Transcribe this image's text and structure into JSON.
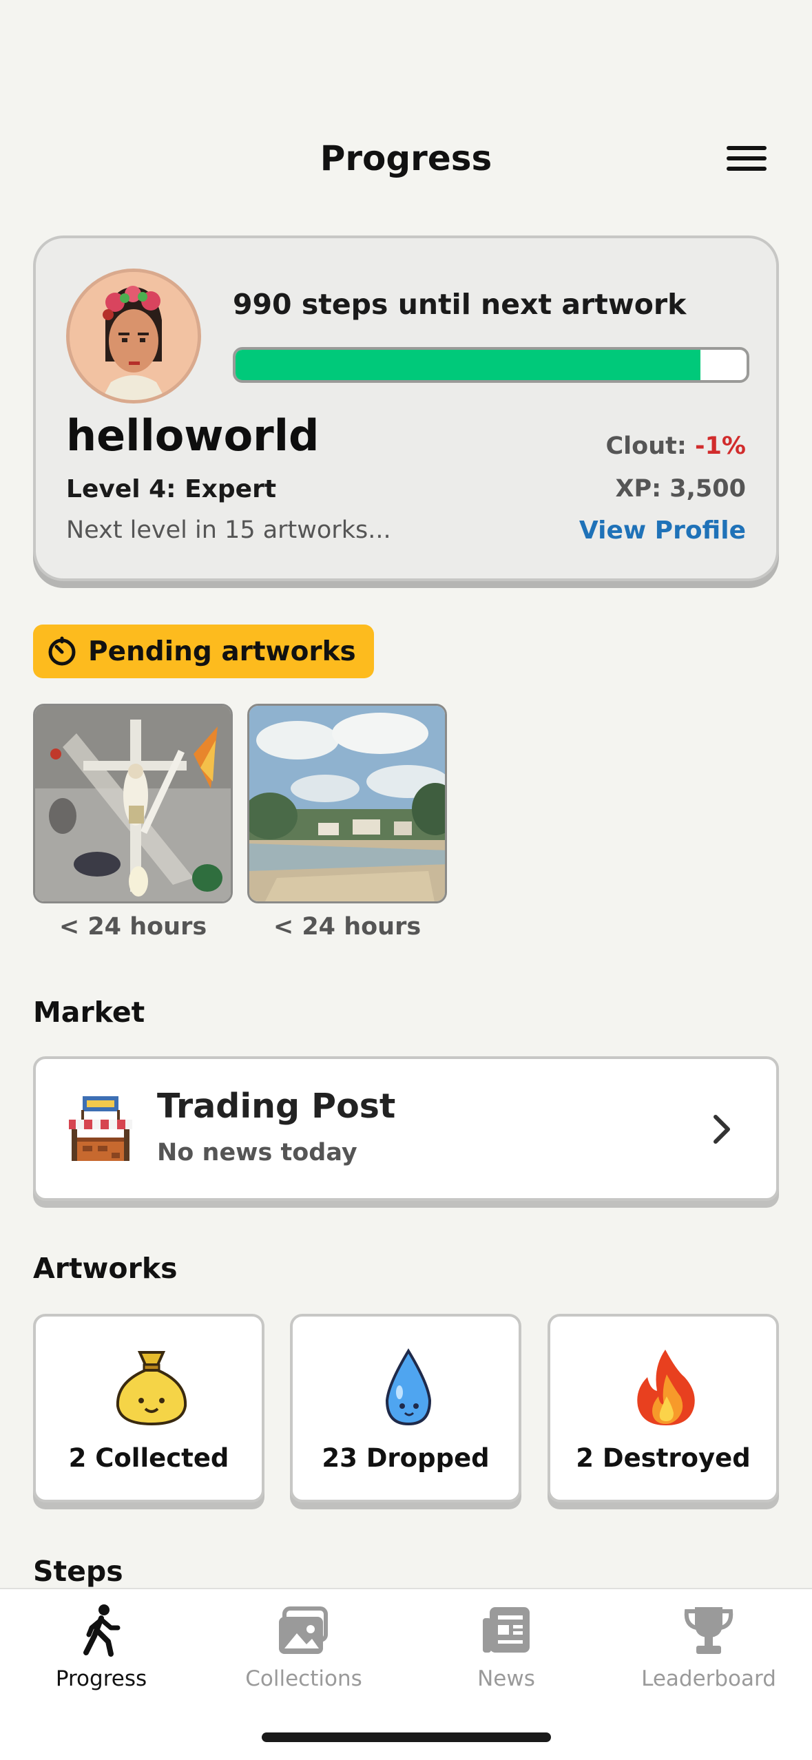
{
  "header": {
    "title": "Progress",
    "menu_icon": "hamburger-menu-icon"
  },
  "profile": {
    "steps_text": "990 steps until next artwork",
    "steps_progress": 0.91,
    "username": "helloworld",
    "level": "Level 4: Expert",
    "next_level": "Next level in 15 artworks...",
    "clout_label": "Clout:",
    "clout_value": "-1%",
    "xp": "XP: 3,500",
    "view_profile": "View Profile"
  },
  "pending": {
    "label": "Pending artworks",
    "icon": "timer-icon",
    "items": [
      {
        "caption": "< 24 hours",
        "artwork": "crucifixion-painting"
      },
      {
        "caption": "< 24 hours",
        "artwork": "riverside-landscape-painting"
      }
    ]
  },
  "market": {
    "section_title": "Market",
    "title": "Trading Post",
    "subtitle": "No news today",
    "icon": "market-stall-icon"
  },
  "artworks": {
    "section_title": "Artworks",
    "items": [
      {
        "label": "2 Collected",
        "icon": "money-bag-icon"
      },
      {
        "label": "23 Dropped",
        "icon": "water-drop-icon"
      },
      {
        "label": "2 Destroyed",
        "icon": "fire-icon"
      }
    ]
  },
  "steps_section": {
    "title": "Steps"
  },
  "tabs": [
    {
      "label": "Progress",
      "icon": "walking-person-icon",
      "active": true
    },
    {
      "label": "Collections",
      "icon": "gallery-icon",
      "active": false
    },
    {
      "label": "News",
      "icon": "newspaper-icon",
      "active": false
    },
    {
      "label": "Leaderboard",
      "icon": "trophy-icon",
      "active": false
    }
  ],
  "colors": {
    "progress": "#00c97a",
    "badge": "#fdbb1e",
    "link": "#1f72b8",
    "negative": "#d12c2c"
  }
}
